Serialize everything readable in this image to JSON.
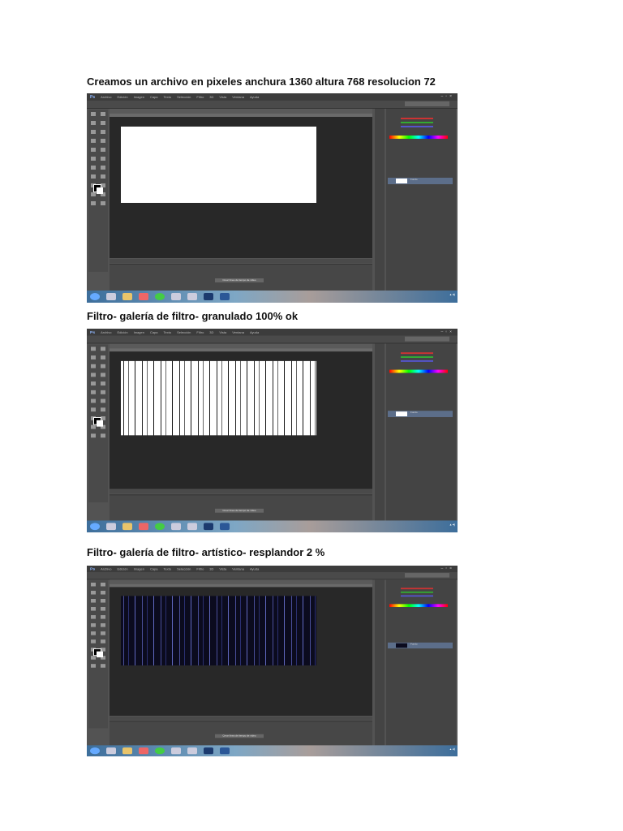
{
  "captions": [
    "Creamos un archivo en pixeles anchura 1360 altura 768 resolucion 72",
    "Filtro- galería de filtro- granulado 100% ok",
    "Filtro- galería de filtro- artístico- resplandor 2 %"
  ],
  "photoshop": {
    "logo": "Ps",
    "menu": [
      "Archivo",
      "Edición",
      "Imagen",
      "Capa",
      "Texto",
      "Selección",
      "Filtro",
      "3D",
      "Vista",
      "Ventana",
      "Ayuda"
    ],
    "timeline_button": "Crear línea de tiempo de vídeo",
    "layer_name": "Fondo"
  }
}
